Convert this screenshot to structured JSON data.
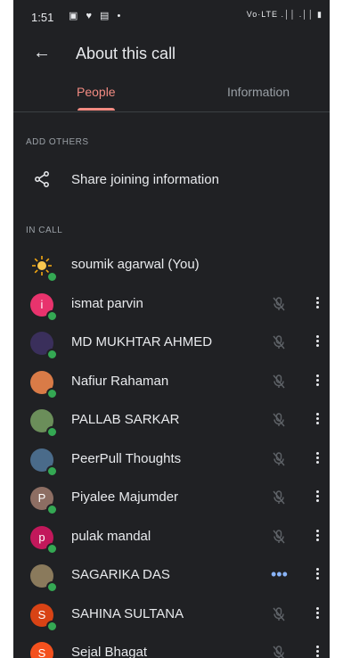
{
  "status_bar": {
    "time": "1:51",
    "left_icons": "▣ ♥ ▤ •",
    "right_icons": "Vo·LTE .││ .││ ▮"
  },
  "header": {
    "title": "About this call",
    "back_icon": "arrow-back-icon"
  },
  "tabs": [
    {
      "label": "People",
      "active": true
    },
    {
      "label": "Information",
      "active": false
    }
  ],
  "colors": {
    "background": "#202124",
    "accent": "#f28b82",
    "online": "#34a853",
    "speaking": "#8ab4f8"
  },
  "add_others": {
    "section_label": "ADD OTHERS",
    "share_label": "Share joining information",
    "share_icon": "share-icon"
  },
  "in_call": {
    "section_label": "IN CALL",
    "participants": [
      {
        "name": "soumik agarwal (You)",
        "avatar_letter": "",
        "avatar_color": "#202124",
        "avatar_kind": "sun",
        "muted": false,
        "speaking": false,
        "show_actions": false
      },
      {
        "name": "ismat parvin",
        "avatar_letter": "i",
        "avatar_color": "#e8336d",
        "muted": true,
        "speaking": false,
        "show_actions": true
      },
      {
        "name": "MD MUKHTAR AHMED",
        "avatar_letter": "",
        "avatar_color": "#3a2f5b",
        "muted": true,
        "speaking": false,
        "show_actions": true
      },
      {
        "name": "Nafiur Rahaman",
        "avatar_letter": "",
        "avatar_color": "#d97b47",
        "muted": true,
        "speaking": false,
        "show_actions": true
      },
      {
        "name": "PALLAB SARKAR",
        "avatar_letter": "",
        "avatar_color": "#6b8e5a",
        "muted": true,
        "speaking": false,
        "show_actions": true
      },
      {
        "name": "PeerPull Thoughts",
        "avatar_letter": "",
        "avatar_color": "#4a6b8a",
        "muted": true,
        "speaking": false,
        "show_actions": true
      },
      {
        "name": "Piyalee Majumder",
        "avatar_letter": "P",
        "avatar_color": "#8d6e63",
        "muted": true,
        "speaking": false,
        "show_actions": true
      },
      {
        "name": "pulak mandal",
        "avatar_letter": "p",
        "avatar_color": "#c2185b",
        "muted": true,
        "speaking": false,
        "show_actions": true
      },
      {
        "name": "SAGARIKA DAS",
        "avatar_letter": "",
        "avatar_color": "#8a7a5c",
        "muted": false,
        "speaking": true,
        "show_actions": true
      },
      {
        "name": "SAHINA SULTANA",
        "avatar_letter": "S",
        "avatar_color": "#d84315",
        "muted": true,
        "speaking": false,
        "show_actions": true
      },
      {
        "name": "Sejal Bhagat",
        "avatar_letter": "S",
        "avatar_color": "#f4511e",
        "muted": true,
        "speaking": false,
        "show_actions": true
      }
    ]
  }
}
